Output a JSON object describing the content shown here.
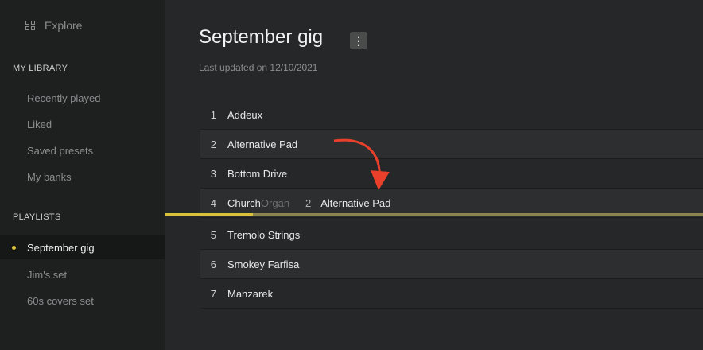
{
  "sidebar": {
    "explore_label": "Explore",
    "library_heading": "MY LIBRARY",
    "library_items": [
      {
        "label": "Recently played"
      },
      {
        "label": "Liked"
      },
      {
        "label": "Saved presets"
      },
      {
        "label": "My banks"
      }
    ],
    "playlists_heading": "PLAYLISTS",
    "playlists": [
      {
        "label": "September gig",
        "active": true
      },
      {
        "label": "Jim's set",
        "active": false
      },
      {
        "label": "60s covers set",
        "active": false
      }
    ]
  },
  "main": {
    "title": "September gig",
    "more_button": "⋮",
    "last_updated": "Last updated on 12/10/2021",
    "tracks": [
      {
        "num": "1",
        "name": "Addeux"
      },
      {
        "num": "2",
        "name": "Alternative Pad"
      },
      {
        "num": "3",
        "name": "Bottom Drive"
      },
      {
        "num": "4",
        "name": "Church",
        "name_faded": " Organ"
      },
      {
        "num": "5",
        "name": "Tremolo Strings"
      },
      {
        "num": "6",
        "name": "Smokey Farfisa"
      },
      {
        "num": "7",
        "name": "Manzarek"
      }
    ],
    "drag_ghost": {
      "num": "2",
      "name": "Alternative Pad"
    }
  },
  "colors": {
    "accent": "#d9c23a",
    "arrow": "#e8402a",
    "sidebar_bg": "#1e2020",
    "main_bg": "#262729"
  },
  "icons": {
    "explore": "grid-icon",
    "more": "more-vertical-icon",
    "drag_annotation": "curved-arrow-icon"
  }
}
